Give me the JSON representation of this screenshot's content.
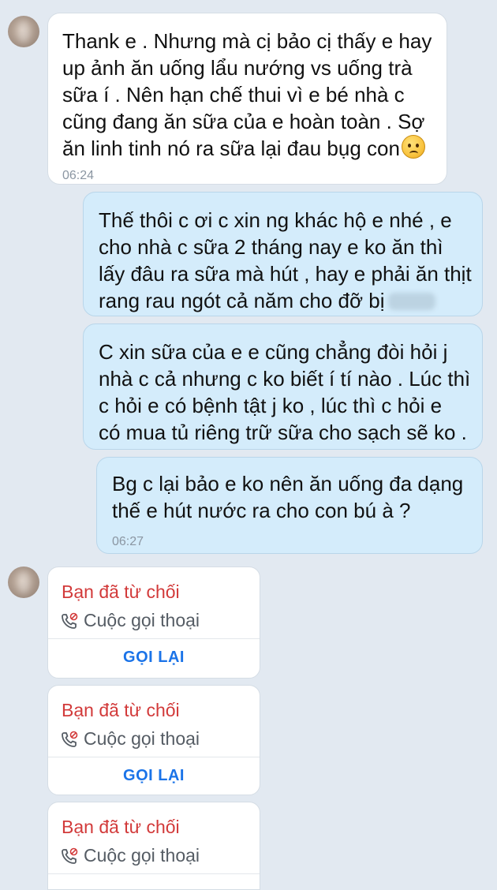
{
  "messages": [
    {
      "direction": "incoming",
      "lines": [
        "Thank e . Nhưng mà cị bảo cị thấy e hay",
        "up ảnh ăn uống lẩu nướng vs uống trà",
        "sữa í . Nên hạn chế thui vì e bé nhà c",
        "cũng đang ăn sữa của e hoàn toàn . Sợ",
        "ăn linh tinh nó ra sữa lại đau bụg con"
      ],
      "emoji": "frowning-face-emoji",
      "time": "06:24"
    },
    {
      "direction": "outgoing",
      "lines": [
        "Thế thôi c ơi c xin ng khác hộ e nhé , e",
        "cho nhà c sữa 2 tháng nay e ko ăn thì",
        "lấy đâu ra sữa mà hút , hay e phải ăn thịt",
        "rang rau ngót cả năm cho đỡ bị"
      ]
    },
    {
      "direction": "outgoing",
      "lines": [
        "C xin sữa của e e cũng chẳng đòi hỏi j",
        "nhà c cả nhưng c ko biết í tí nào . Lúc thì",
        "c hỏi e có bệnh tật j ko , lúc thì c hỏi e",
        "có mua tủ riêng trữ sữa cho sạch sẽ ko ."
      ]
    },
    {
      "direction": "outgoing",
      "lines": [
        "Bg c lại bảo e ko nên ăn uống đa dạng",
        "thế e hút nước ra cho con bú à ?"
      ],
      "time": "06:27"
    }
  ],
  "calls": [
    {
      "status": "Bạn đã từ chối",
      "type": "Cuộc gọi thoại",
      "action": "GỌI LẠI",
      "icon": "missed-call-icon"
    },
    {
      "status": "Bạn đã từ chối",
      "type": "Cuộc gọi thoại",
      "action": "GỌI LẠI",
      "icon": "missed-call-icon"
    },
    {
      "status": "Bạn đã từ chối",
      "type": "Cuộc gọi thoại",
      "icon": "missed-call-icon"
    }
  ],
  "colors": {
    "background": "#e2e9f1",
    "incoming_bubble": "#ffffff",
    "outgoing_bubble": "#d4ecfb",
    "declined_red": "#d23a3a",
    "callback_blue": "#1a73e8"
  }
}
